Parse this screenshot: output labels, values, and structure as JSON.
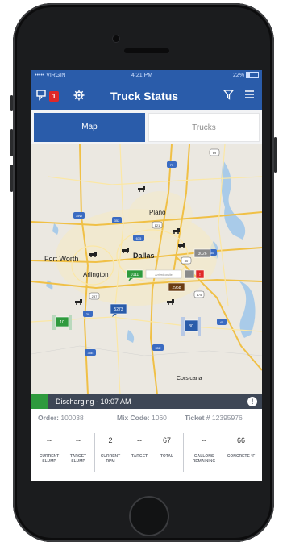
{
  "status_bar": {
    "carrier": "••••• VIRGIN",
    "time": "4:21 PM",
    "battery": "22%"
  },
  "nav": {
    "title": "Truck Status",
    "badge_count": "1"
  },
  "tabs": [
    {
      "label": "Map",
      "active": true
    },
    {
      "label": "Trucks",
      "active": false
    }
  ],
  "map": {
    "cities": {
      "plano": "Plano",
      "fort_worth": "Fort Worth",
      "dallas": "Dallas",
      "arlington": "Arlington",
      "corsicana": "Corsicana"
    },
    "highway_shields": [
      "75",
      "69",
      "35W",
      "352",
      "635",
      "121",
      "80",
      "287",
      "20",
      "175",
      "30",
      "45",
      "35E",
      "35E"
    ],
    "truck_tags": {
      "green_tag": "0111",
      "gray_tag": "3026",
      "brown_tag": "2958",
      "blue_tag": "5273",
      "green_cluster": "10",
      "blue_cluster": "30",
      "tooltip": "Arrived onsite",
      "alert_badge": "!"
    }
  },
  "truck": {
    "status": "Discharging - 10:07 AM",
    "order_label": "Order:",
    "order": "100038",
    "mix_label": "Mix Code:",
    "mix_code": "1060",
    "ticket_label": "Ticket #",
    "ticket": "12395976"
  },
  "metrics": [
    {
      "value": "--",
      "label": "CURRENT SLUMP"
    },
    {
      "value": "--",
      "label": "TARGET SLUMP"
    },
    {
      "value": "2",
      "label": "CURRENT RPM"
    },
    {
      "value": "--",
      "label": "TARGET"
    },
    {
      "value": "67",
      "label": "TOTAL"
    },
    {
      "value": "--",
      "label": "GALLONS REMAINING"
    },
    {
      "value": "66",
      "label": "CONCRETE °F"
    }
  ],
  "colors": {
    "primary": "#2a5caa",
    "status_strip": "#3e4756",
    "status_green": "#2e9a3d",
    "alert": "#e02828"
  }
}
